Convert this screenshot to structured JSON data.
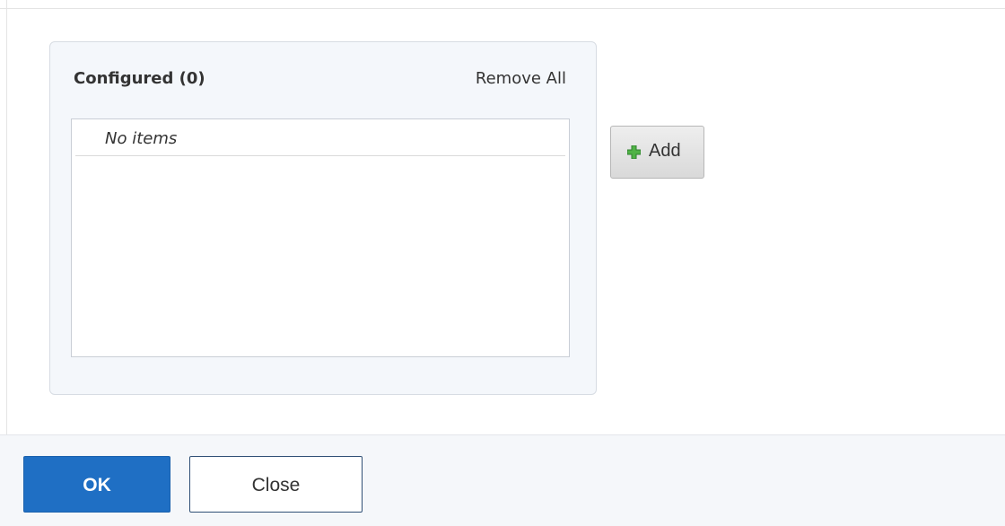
{
  "configured_panel": {
    "title": "Configured (0)",
    "remove_all_label": "Remove All",
    "empty_message": "No items"
  },
  "actions": {
    "add_label": "Add",
    "add_icon": "plus-icon"
  },
  "footer": {
    "ok_label": "OK",
    "close_label": "Close"
  },
  "colors": {
    "primary_button": "#1f6fc4",
    "panel_background": "#f4f7fb",
    "plus_icon": "#4fb245"
  }
}
